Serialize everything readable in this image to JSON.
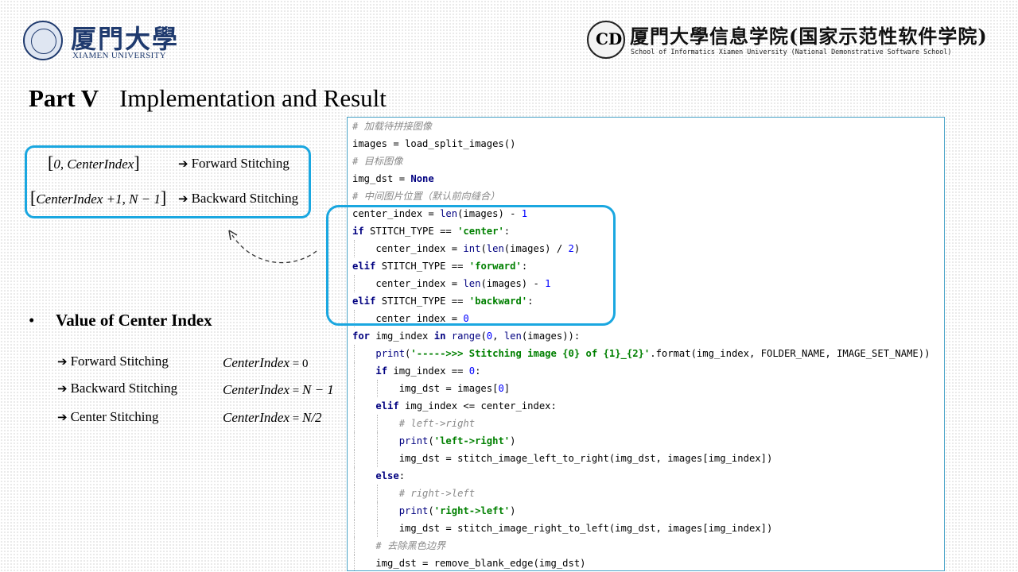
{
  "header": {
    "university_cn": "厦門大學",
    "university_en": "XIAMEN UNIVERSITY",
    "school_cn": "厦門大學信息学院(国家示范性软件学院)",
    "school_en": "School of Informatics Xiamen University (National Demonstrative Software School)",
    "seal_right_text": "CD"
  },
  "slide": {
    "part": "Part V",
    "title": "Implementation and Result"
  },
  "ranges": {
    "forward_range": "CenterIndex",
    "forward_label": "Forward Stitching",
    "backward_range": "CenterIndex +1, N − 1",
    "backward_label": "Backward Stitching"
  },
  "center_index": {
    "bullet": "•",
    "heading": "Value of Center Index",
    "items": [
      {
        "label": "Forward Stitching",
        "formula": "0"
      },
      {
        "label": "Backward Stitching",
        "formula": "N − 1"
      },
      {
        "label": "Center Stitching",
        "formula": "N/2"
      }
    ],
    "var": "CenterIndex"
  },
  "icons": {
    "arrow": "➔",
    "arrow_name": "right-arrow-icon"
  },
  "colors": {
    "accent": "#1aa7e0",
    "keyword": "#000080",
    "string": "#008000",
    "number": "#0000ff",
    "comment": "#8a8a8a"
  },
  "code": {
    "lines": [
      "# 加载待拼接图像",
      "images = load_split_images()",
      "# 目标图像",
      "img_dst = None",
      "# 中间图片位置（默认前向缝合）",
      "center_index = len(images) - 1",
      "if STITCH_TYPE == 'center':",
      "    center_index = int(len(images) / 2)",
      "elif STITCH_TYPE == 'forward':",
      "    center_index = len(images) - 1",
      "elif STITCH_TYPE == 'backward':",
      "    center_index = 0",
      "for img_index in range(0, len(images)):",
      "    print('----->>> Stitching image {0} of {1}_{2}'.format(img_index, FOLDER_NAME, IMAGE_SET_NAME))",
      "    if img_index == 0:",
      "        img_dst = images[0]",
      "    elif img_index <= center_index:",
      "        # left->right",
      "        print('left->right')",
      "        img_dst = stitch_image_left_to_right(img_dst, images[img_index])",
      "    else:",
      "        # right->left",
      "        print('right->left')",
      "        img_dst = stitch_image_right_to_left(img_dst, images[img_index])",
      "    # 去除黑色边界",
      "    img_dst = remove_blank_edge(img_dst)"
    ]
  }
}
